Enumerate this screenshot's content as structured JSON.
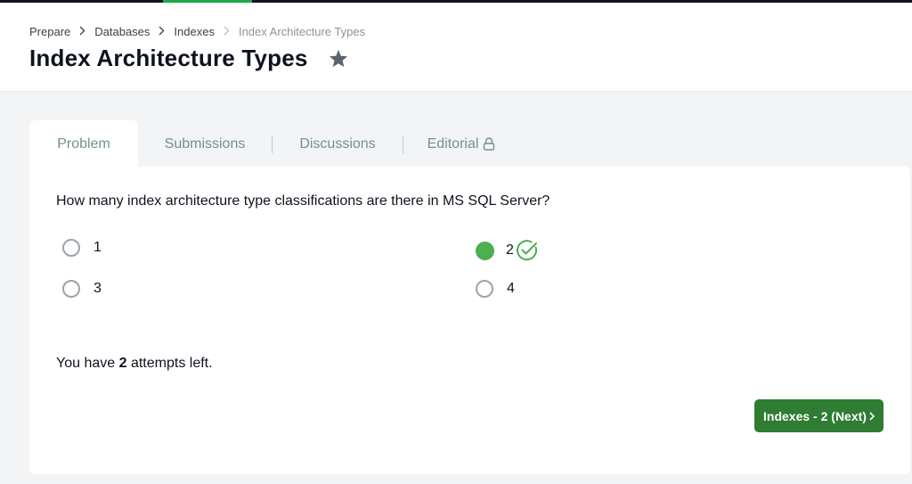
{
  "breadcrumb": [
    "Prepare",
    "Databases",
    "Indexes",
    "Index Architecture Types"
  ],
  "page_title": "Index Architecture Types",
  "tabs": [
    {
      "label": "Problem",
      "active": true
    },
    {
      "label": "Submissions",
      "active": false
    },
    {
      "label": "Discussions",
      "active": false
    },
    {
      "label": "Editorial",
      "active": false,
      "icon": "lock-icon"
    }
  ],
  "question": "How many index architecture type classifications are there in MS SQL Server?",
  "options": [
    {
      "label": "1",
      "selected": false
    },
    {
      "label": "2",
      "selected": true,
      "correct": true
    },
    {
      "label": "3",
      "selected": false
    },
    {
      "label": "4",
      "selected": false
    }
  ],
  "attempts": {
    "prefix": "You have",
    "count": "2",
    "suffix": "attempts left."
  },
  "next_button": {
    "label": "Indexes - 2 (Next)"
  },
  "colors": {
    "accent_green": "#1ba94c",
    "button_green": "#2e7d32",
    "selected_radio": "#4caf50"
  }
}
